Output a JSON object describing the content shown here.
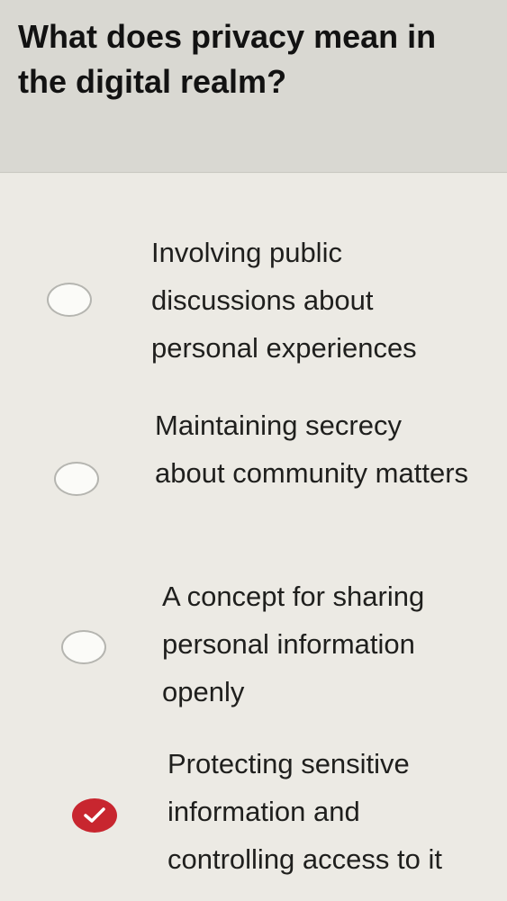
{
  "question": {
    "title": "What does privacy mean in the digital realm?"
  },
  "options": [
    {
      "label": "Involving public discussions about personal experiences",
      "selected": false
    },
    {
      "label": "Maintaining secrecy about community matters",
      "selected": false
    },
    {
      "label": "A concept for sharing personal information openly",
      "selected": false
    },
    {
      "label": "Protecting sensitive information and controlling access to it",
      "selected": true
    }
  ],
  "colors": {
    "selected_accent": "#c8262f"
  },
  "icons": {
    "selected": "check-icon"
  }
}
